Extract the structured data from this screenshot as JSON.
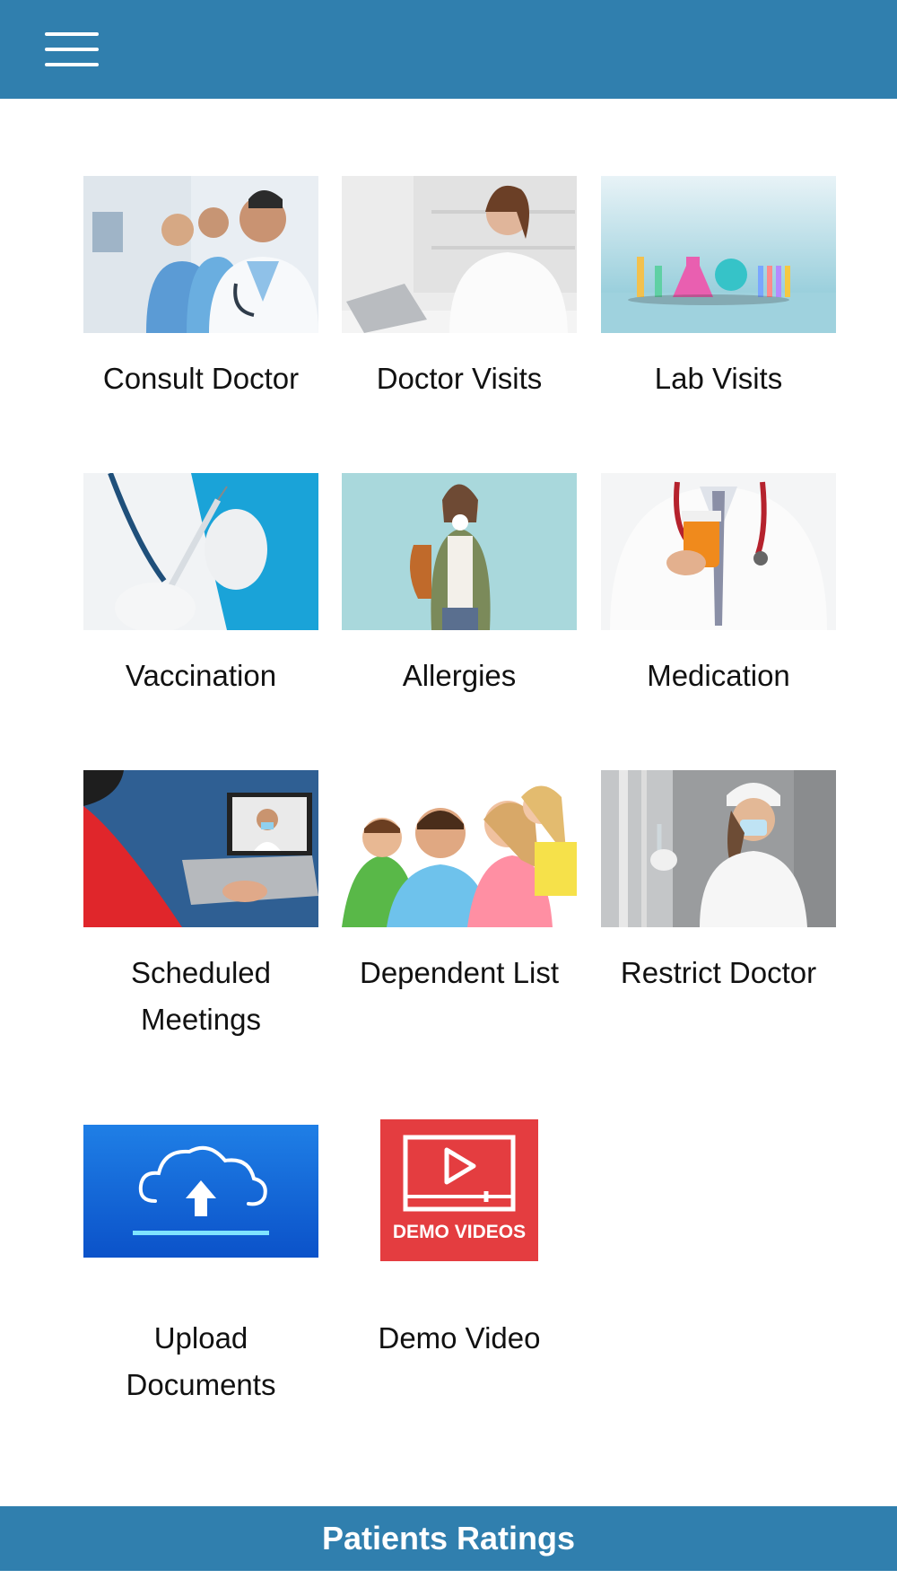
{
  "header": {
    "menu_icon": "hamburger-menu-icon",
    "bg_color": "#307fae"
  },
  "tiles": [
    {
      "label": "Consult Doctor",
      "image": "doctors-team-photo"
    },
    {
      "label": "Doctor Visits",
      "image": "doctor-on-phone-photo"
    },
    {
      "label": "Lab Visits",
      "image": "lab-glassware-photo"
    },
    {
      "label": "Vaccination",
      "image": "vaccine-syringe-photo"
    },
    {
      "label": "Allergies",
      "image": "woman-sneezing-photo"
    },
    {
      "label": "Medication",
      "image": "doctor-holding-pills-photo"
    },
    {
      "label": "Scheduled Meetings",
      "image": "video-call-laptop-photo"
    },
    {
      "label": "Dependent List",
      "image": "family-photo"
    },
    {
      "label": "Restrict Doctor",
      "image": "masked-nurse-photo"
    },
    {
      "label": "Upload Documents",
      "image": "cloud-upload-icon"
    },
    {
      "label": "Demo Video",
      "image": "demo-videos-icon",
      "icon_text": "DEMO VIDEOS"
    }
  ],
  "footer": {
    "label": "Patients Ratings",
    "bg_color": "#307fae"
  }
}
